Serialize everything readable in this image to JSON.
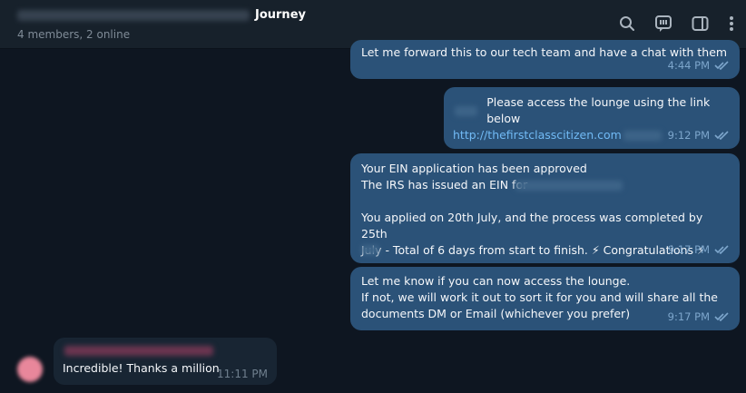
{
  "header": {
    "title": "Journey",
    "subtitle": "4 members, 2 online",
    "icons": [
      "search-icon",
      "comments-icon",
      "sidebar-icon",
      "more-icon"
    ]
  },
  "messages": [
    {
      "text": "Let me forward this to our tech team and have a chat with them",
      "time": "4:44 PM"
    },
    {
      "text": "Please access the lounge using the link below",
      "link": "http://thefirstclasscitizen.com",
      "time": "9:12 PM"
    },
    {
      "text": "Your EIN application has been approved\nThe IRS has issued an EIN for\n\nYou applied on 20th July, and the process was completed by 25th\nJuly - Total of 6 days from start to finish. ⚡ Congratulations ⚡",
      "time": "9:17 PM"
    },
    {
      "text": "Let me know if you can now access the lounge.\nIf not, we will work it out to sort it for you and will share all the\ndocuments DM or Email (whichever you prefer)",
      "time": "9:17 PM"
    }
  ],
  "incoming": {
    "text": "Incredible! Thanks a million",
    "time": "11:11 PM"
  },
  "colors": {
    "accent": "#2b5278",
    "background": "#0e1621",
    "link": "#71baf5"
  }
}
